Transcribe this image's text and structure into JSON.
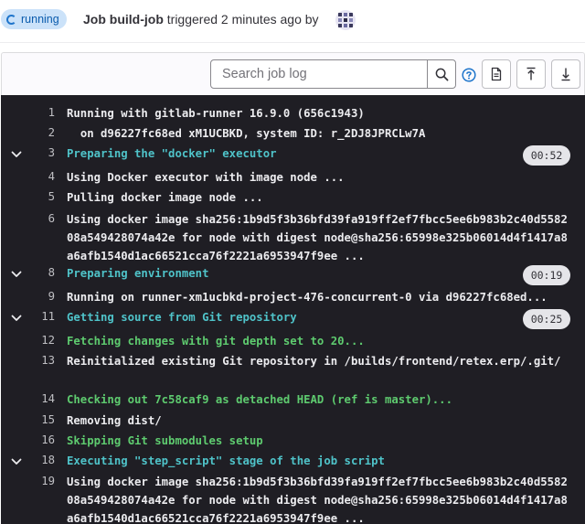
{
  "header": {
    "status": "running",
    "job_label": "Job build-job",
    "triggered_text": "triggered 2 minutes ago by"
  },
  "toolbar": {
    "search_placeholder": "Search job log"
  },
  "colors": {
    "log_background": "#1f1e24",
    "section_header": "#4fc3c9",
    "success_text": "#5ecb6f",
    "status_badge": "#cbe2f9"
  },
  "log": [
    {
      "num": "1",
      "text": "Running with gitlab-runner 16.9.0 (656c1943)"
    },
    {
      "num": "2",
      "text": "  on d96227fc68ed xM1UCBKD, system ID: r_2DJ8JPRCLw7A"
    },
    {
      "num": "3",
      "text": "Preparing the \"docker\" executor",
      "duration": "00:52"
    },
    {
      "num": "4",
      "text": "Using Docker executor with image node ..."
    },
    {
      "num": "5",
      "text": "Pulling docker image node ..."
    },
    {
      "num": "6",
      "text": "Using docker image sha256:1b9d5f3b36bfd39fa919ff2ef7fbcc5ee6b983b2c40d558208a549428074a42e for node with digest node@sha256:65998e325b06014d4f1417a8a6afb1540d1ac66521cca76f2221a6953947f9ee ..."
    },
    {
      "num": "8",
      "text": "Preparing environment",
      "duration": "00:19"
    },
    {
      "num": "9",
      "text": "Running on runner-xm1ucbkd-project-476-concurrent-0 via d96227fc68ed..."
    },
    {
      "num": "11",
      "text": "Getting source from Git repository",
      "duration": "00:25"
    },
    {
      "num": "12",
      "text": "Fetching changes with git depth set to 20..."
    },
    {
      "num": "13",
      "text": "Reinitialized existing Git repository in /builds/frontend/retex.erp/.git/"
    },
    {
      "num": "14",
      "text": "Checking out 7c58caf9 as detached HEAD (ref is master)..."
    },
    {
      "num": "15",
      "text": "Removing dist/"
    },
    {
      "num": "16",
      "text": "Skipping Git submodules setup"
    },
    {
      "num": "18",
      "text": "Executing \"step_script\" stage of the job script"
    },
    {
      "num": "19",
      "text": "Using docker image sha256:1b9d5f3b36bfd39fa919ff2ef7fbcc5ee6b983b2c40d558208a549428074a42e for node with digest node@sha256:65998e325b06014d4f1417a8a6afb1540d1ac66521cca76f2221a6953947f9ee ..."
    }
  ]
}
